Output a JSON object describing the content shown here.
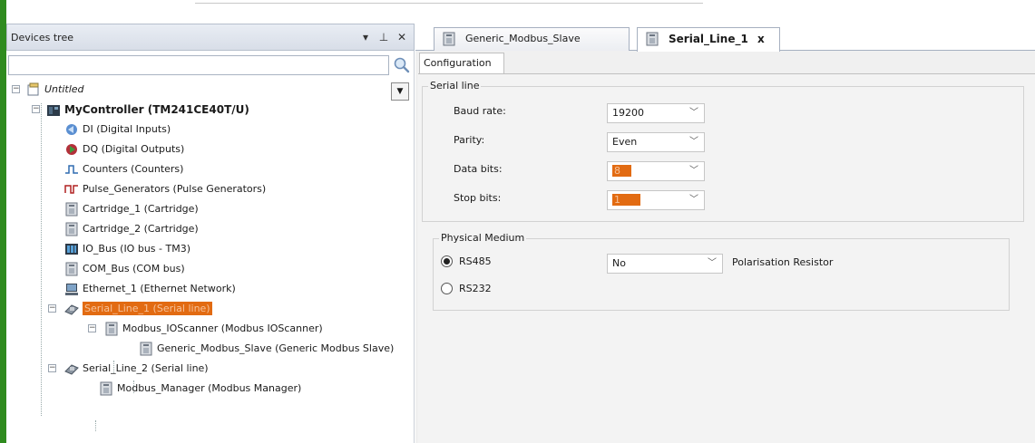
{
  "tree_panel": {
    "title": "Devices tree",
    "controls": [
      "▾",
      "⊥",
      "✕"
    ],
    "search": {
      "value": "",
      "placeholder": ""
    },
    "nodes": [
      {
        "label": "Untitled",
        "icon": "project-icon"
      },
      {
        "label": "MyController (TM241CE40T/U)",
        "icon": "controller-icon"
      },
      {
        "label": "DI (Digital Inputs)",
        "icon": "digital-inputs-icon"
      },
      {
        "label": "DQ (Digital Outputs)",
        "icon": "digital-outputs-icon"
      },
      {
        "label": "Counters (Counters)",
        "icon": "counters-icon"
      },
      {
        "label": "Pulse_Generators (Pulse Generators)",
        "icon": "pulse-icon"
      },
      {
        "label": "Cartridge_1 (Cartridge)",
        "icon": "module-icon"
      },
      {
        "label": "Cartridge_2 (Cartridge)",
        "icon": "module-icon"
      },
      {
        "label": "IO_Bus (IO bus - TM3)",
        "icon": "io-bus-icon"
      },
      {
        "label": "COM_Bus (COM bus)",
        "icon": "module-icon"
      },
      {
        "label": "Ethernet_1 (Ethernet Network)",
        "icon": "ethernet-icon"
      },
      {
        "label": "Serial_Line_1 (Serial line)",
        "icon": "serial-line-icon"
      },
      {
        "label": "Modbus_IOScanner (Modbus IOScanner)",
        "icon": "module-icon"
      },
      {
        "label": "Generic_Modbus_Slave (Generic Modbus Slave)",
        "icon": "module-icon"
      },
      {
        "label": "Serial_Line_2 (Serial line)",
        "icon": "serial-line-icon"
      },
      {
        "label": "Modbus_Manager (Modbus Manager)",
        "icon": "module-icon"
      }
    ]
  },
  "editor": {
    "tabs": [
      {
        "label": "Generic_Modbus_Slave"
      },
      {
        "label": "Serial_Line_1"
      }
    ],
    "tab_close": "x",
    "sub_tab": "Configuration",
    "serial_line": {
      "title": "Serial line",
      "baud_rate": {
        "label": "Baud rate:",
        "value": "19200"
      },
      "parity": {
        "label": "Parity:",
        "value": "Even"
      },
      "data_bits": {
        "label": "Data bits:",
        "value": "8"
      },
      "stop_bits": {
        "label": "Stop bits:",
        "value": "1"
      }
    },
    "physical_medium": {
      "title": "Physical Medium",
      "rs485": "RS485",
      "rs232": "RS232",
      "polarisation_value": "No",
      "polarisation_label": "Polarisation Resistor"
    }
  },
  "colors": {
    "accent_green": "#2f8b1f",
    "highlight_orange": "#e26b12"
  }
}
